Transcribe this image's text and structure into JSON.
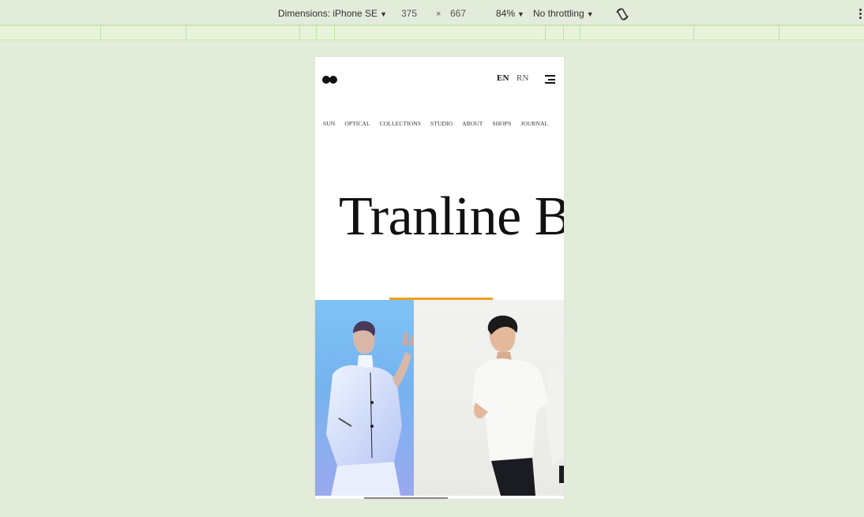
{
  "devtools": {
    "dimensions_label": "Dimensions: iPhone SE",
    "width": "375",
    "times": "×",
    "height": "667",
    "zoom": "84%",
    "throttling": "No throttling",
    "rotate_icon": "rotate-icon",
    "more_icon": "more-vertical-icon"
  },
  "site": {
    "lang_en": "EN",
    "lang_rn": "RN",
    "nav": [
      "SUN",
      "OPTICAL",
      "COLLECTIONS",
      "STUDIO",
      "ABOUT",
      "SHOPS",
      "JOURNAL"
    ],
    "hero_title": "Tranline Bra",
    "accent_color": "#f0a020"
  }
}
